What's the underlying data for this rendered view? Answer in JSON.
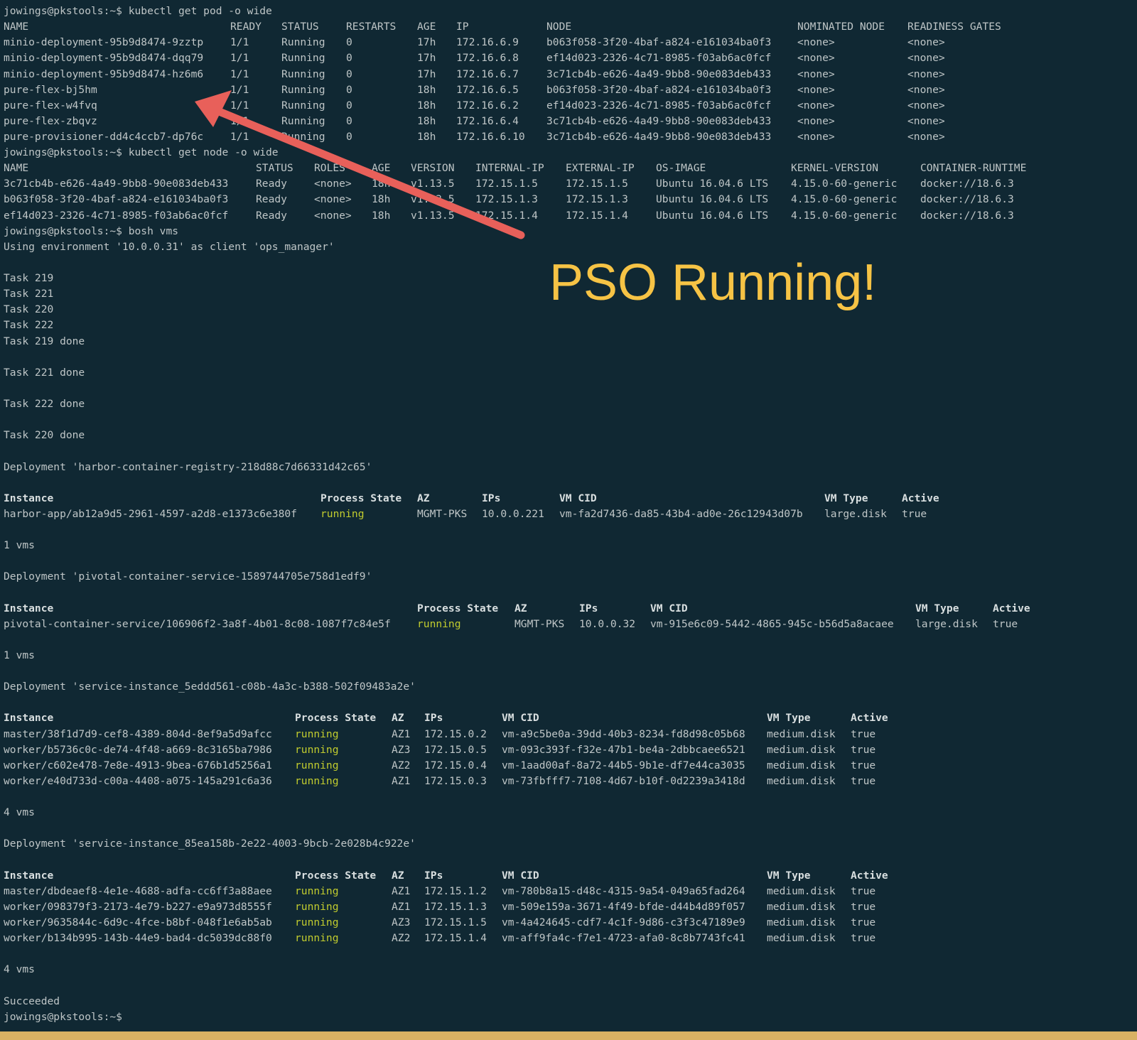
{
  "colors": {
    "background": "#102833",
    "text": "#bfc6c7",
    "running": "#c2cc2e",
    "annotation_text": "#f6c345",
    "arrow": "#e8605a",
    "frame": "#d8b163"
  },
  "annotation": {
    "text": "PSO Running!"
  },
  "prompt": "jowings@pkstools:~$",
  "lines": [
    {
      "t": 0,
      "text": "jowings@pkstools:~$ kubectl get pod -o wide"
    },
    {
      "t": 1,
      "cols": [
        [
          0,
          "NAME"
        ],
        [
          319,
          "READY"
        ],
        [
          391,
          "STATUS"
        ],
        [
          482,
          "RESTARTS"
        ],
        [
          582,
          "AGE"
        ],
        [
          637,
          "IP"
        ],
        [
          764,
          "NODE"
        ],
        [
          1117,
          "NOMINATED NODE"
        ],
        [
          1272,
          "READINESS GATES"
        ]
      ]
    },
    {
      "t": 1,
      "cols": [
        [
          0,
          "minio-deployment-95b9d8474-9zztp"
        ],
        [
          319,
          "1/1"
        ],
        [
          391,
          "Running"
        ],
        [
          482,
          "0"
        ],
        [
          582,
          "17h"
        ],
        [
          637,
          "172.16.6.9"
        ],
        [
          764,
          "b063f058-3f20-4baf-a824-e161034ba0f3"
        ],
        [
          1117,
          "<none>"
        ],
        [
          1272,
          "<none>"
        ]
      ]
    },
    {
      "t": 1,
      "cols": [
        [
          0,
          "minio-deployment-95b9d8474-dqq79"
        ],
        [
          319,
          "1/1"
        ],
        [
          391,
          "Running"
        ],
        [
          482,
          "0"
        ],
        [
          582,
          "17h"
        ],
        [
          637,
          "172.16.6.8"
        ],
        [
          764,
          "ef14d023-2326-4c71-8985-f03ab6ac0fcf"
        ],
        [
          1117,
          "<none>"
        ],
        [
          1272,
          "<none>"
        ]
      ]
    },
    {
      "t": 1,
      "cols": [
        [
          0,
          "minio-deployment-95b9d8474-hz6m6"
        ],
        [
          319,
          "1/1"
        ],
        [
          391,
          "Running"
        ],
        [
          482,
          "0"
        ],
        [
          582,
          "17h"
        ],
        [
          637,
          "172.16.6.7"
        ],
        [
          764,
          "3c71cb4b-e626-4a49-9bb8-90e083deb433"
        ],
        [
          1117,
          "<none>"
        ],
        [
          1272,
          "<none>"
        ]
      ]
    },
    {
      "t": 1,
      "cols": [
        [
          0,
          "pure-flex-bj5hm"
        ],
        [
          319,
          "1/1"
        ],
        [
          391,
          "Running"
        ],
        [
          482,
          "0"
        ],
        [
          582,
          "18h"
        ],
        [
          637,
          "172.16.6.5"
        ],
        [
          764,
          "b063f058-3f20-4baf-a824-e161034ba0f3"
        ],
        [
          1117,
          "<none>"
        ],
        [
          1272,
          "<none>"
        ]
      ]
    },
    {
      "t": 1,
      "cols": [
        [
          0,
          "pure-flex-w4fvq"
        ],
        [
          319,
          "1/1"
        ],
        [
          391,
          "Running"
        ],
        [
          482,
          "0"
        ],
        [
          582,
          "18h"
        ],
        [
          637,
          "172.16.6.2"
        ],
        [
          764,
          "ef14d023-2326-4c71-8985-f03ab6ac0fcf"
        ],
        [
          1117,
          "<none>"
        ],
        [
          1272,
          "<none>"
        ]
      ]
    },
    {
      "t": 1,
      "cols": [
        [
          0,
          "pure-flex-zbqvz"
        ],
        [
          319,
          "1/1"
        ],
        [
          391,
          "Running"
        ],
        [
          482,
          "0"
        ],
        [
          582,
          "18h"
        ],
        [
          637,
          "172.16.6.4"
        ],
        [
          764,
          "3c71cb4b-e626-4a49-9bb8-90e083deb433"
        ],
        [
          1117,
          "<none>"
        ],
        [
          1272,
          "<none>"
        ]
      ]
    },
    {
      "t": 1,
      "cols": [
        [
          0,
          "pure-provisioner-dd4c4ccb7-dp76c"
        ],
        [
          319,
          "1/1"
        ],
        [
          391,
          "Running"
        ],
        [
          482,
          "0"
        ],
        [
          582,
          "18h"
        ],
        [
          637,
          "172.16.6.10"
        ],
        [
          764,
          "3c71cb4b-e626-4a49-9bb8-90e083deb433"
        ],
        [
          1117,
          "<none>"
        ],
        [
          1272,
          "<none>"
        ]
      ]
    },
    {
      "t": 0,
      "text": "jowings@pkstools:~$ kubectl get node -o wide"
    },
    {
      "t": 1,
      "cols": [
        [
          0,
          "NAME"
        ],
        [
          355,
          "STATUS"
        ],
        [
          437,
          "ROLES"
        ],
        [
          518,
          "AGE"
        ],
        [
          573,
          "VERSION"
        ],
        [
          664,
          "INTERNAL-IP"
        ],
        [
          791,
          "EXTERNAL-IP"
        ],
        [
          918,
          "OS-IMAGE"
        ],
        [
          1108,
          "KERNEL-VERSION"
        ],
        [
          1290,
          "CONTAINER-RUNTIME"
        ]
      ]
    },
    {
      "t": 1,
      "cols": [
        [
          0,
          "3c71cb4b-e626-4a49-9bb8-90e083deb433"
        ],
        [
          355,
          "Ready"
        ],
        [
          437,
          "<none>"
        ],
        [
          518,
          "18h"
        ],
        [
          573,
          "v1.13.5"
        ],
        [
          664,
          "172.15.1.5"
        ],
        [
          791,
          "172.15.1.5"
        ],
        [
          918,
          "Ubuntu 16.04.6 LTS"
        ],
        [
          1108,
          "4.15.0-60-generic"
        ],
        [
          1290,
          "docker://18.6.3"
        ]
      ]
    },
    {
      "t": 1,
      "cols": [
        [
          0,
          "b063f058-3f20-4baf-a824-e161034ba0f3"
        ],
        [
          355,
          "Ready"
        ],
        [
          437,
          "<none>"
        ],
        [
          518,
          "18h"
        ],
        [
          573,
          "v1.13.5"
        ],
        [
          664,
          "172.15.1.3"
        ],
        [
          791,
          "172.15.1.3"
        ],
        [
          918,
          "Ubuntu 16.04.6 LTS"
        ],
        [
          1108,
          "4.15.0-60-generic"
        ],
        [
          1290,
          "docker://18.6.3"
        ]
      ]
    },
    {
      "t": 1,
      "cols": [
        [
          0,
          "ef14d023-2326-4c71-8985-f03ab6ac0fcf"
        ],
        [
          355,
          "Ready"
        ],
        [
          437,
          "<none>"
        ],
        [
          518,
          "18h"
        ],
        [
          573,
          "v1.13.5"
        ],
        [
          664,
          "172.15.1.4"
        ],
        [
          791,
          "172.15.1.4"
        ],
        [
          918,
          "Ubuntu 16.04.6 LTS"
        ],
        [
          1108,
          "4.15.0-60-generic"
        ],
        [
          1290,
          "docker://18.6.3"
        ]
      ]
    },
    {
      "t": 0,
      "text": "jowings@pkstools:~$ bosh vms"
    },
    {
      "t": 0,
      "text": "Using environment '10.0.0.31' as client 'ops_manager'"
    },
    {
      "t": 0,
      "text": ""
    },
    {
      "t": 0,
      "text": "Task 219"
    },
    {
      "t": 0,
      "text": "Task 221"
    },
    {
      "t": 0,
      "text": "Task 220"
    },
    {
      "t": 0,
      "text": "Task 222"
    },
    {
      "t": 0,
      "text": "Task 219 done"
    },
    {
      "t": 0,
      "text": ""
    },
    {
      "t": 0,
      "text": "Task 221 done"
    },
    {
      "t": 0,
      "text": ""
    },
    {
      "t": 0,
      "text": "Task 222 done"
    },
    {
      "t": 0,
      "text": ""
    },
    {
      "t": 0,
      "text": "Task 220 done"
    },
    {
      "t": 0,
      "text": ""
    },
    {
      "t": 0,
      "text": "Deployment 'harbor-container-registry-218d88c7d66331d42c65'"
    },
    {
      "t": 0,
      "text": ""
    },
    {
      "t": 2,
      "cols": [
        [
          0,
          "Instance"
        ],
        [
          446,
          "Process State"
        ],
        [
          582,
          "AZ"
        ],
        [
          673,
          "IPs"
        ],
        [
          782,
          "VM CID"
        ],
        [
          1155,
          "VM Type"
        ],
        [
          1264,
          "Active"
        ]
      ]
    },
    {
      "t": 1,
      "run": 1,
      "cols": [
        [
          0,
          "harbor-app/ab12a9d5-2961-4597-a2d8-e1373c6e380f"
        ],
        [
          446,
          "running"
        ],
        [
          582,
          "MGMT-PKS"
        ],
        [
          673,
          "10.0.0.221"
        ],
        [
          782,
          "vm-fa2d7436-da85-43b4-ad0e-26c12943d07b"
        ],
        [
          1155,
          "large.disk"
        ],
        [
          1264,
          "true"
        ]
      ]
    },
    {
      "t": 0,
      "text": ""
    },
    {
      "t": 0,
      "text": "1 vms"
    },
    {
      "t": 0,
      "text": ""
    },
    {
      "t": 0,
      "text": "Deployment 'pivotal-container-service-1589744705e758d1edf9'"
    },
    {
      "t": 0,
      "text": ""
    },
    {
      "t": 2,
      "cols": [
        [
          0,
          "Instance"
        ],
        [
          582,
          "Process State"
        ],
        [
          719,
          "AZ"
        ],
        [
          810,
          "IPs"
        ],
        [
          910,
          "VM CID"
        ],
        [
          1283,
          "VM Type"
        ],
        [
          1392,
          "Active"
        ]
      ]
    },
    {
      "t": 1,
      "run": 1,
      "cols": [
        [
          0,
          "pivotal-container-service/106906f2-3a8f-4b01-8c08-1087f7c84e5f"
        ],
        [
          582,
          "running"
        ],
        [
          719,
          "MGMT-PKS"
        ],
        [
          810,
          "10.0.0.32"
        ],
        [
          910,
          "vm-915e6c09-5442-4865-945c-b56d5a8acaee"
        ],
        [
          1283,
          "large.disk"
        ],
        [
          1392,
          "true"
        ]
      ]
    },
    {
      "t": 0,
      "text": ""
    },
    {
      "t": 0,
      "text": "1 vms"
    },
    {
      "t": 0,
      "text": ""
    },
    {
      "t": 0,
      "text": "Deployment 'service-instance_5eddd561-c08b-4a3c-b388-502f09483a2e'"
    },
    {
      "t": 0,
      "text": ""
    },
    {
      "t": 2,
      "cols": [
        [
          0,
          "Instance"
        ],
        [
          410,
          "Process State"
        ],
        [
          546,
          "AZ"
        ],
        [
          592,
          "IPs"
        ],
        [
          701,
          "VM CID"
        ],
        [
          1074,
          "VM Type"
        ],
        [
          1192,
          "Active"
        ]
      ]
    },
    {
      "t": 1,
      "run": 1,
      "cols": [
        [
          0,
          "master/38f1d7d9-cef8-4389-804d-8ef9a5d9afcc"
        ],
        [
          410,
          "running"
        ],
        [
          546,
          "AZ1"
        ],
        [
          592,
          "172.15.0.2"
        ],
        [
          701,
          "vm-a9c5be0a-39dd-40b3-8234-fd8d98c05b68"
        ],
        [
          1074,
          "medium.disk"
        ],
        [
          1192,
          "true"
        ]
      ]
    },
    {
      "t": 1,
      "run": 1,
      "cols": [
        [
          0,
          "worker/b5736c0c-de74-4f48-a669-8c3165ba7986"
        ],
        [
          410,
          "running"
        ],
        [
          546,
          "AZ3"
        ],
        [
          592,
          "172.15.0.5"
        ],
        [
          701,
          "vm-093c393f-f32e-47b1-be4a-2dbbcaee6521"
        ],
        [
          1074,
          "medium.disk"
        ],
        [
          1192,
          "true"
        ]
      ]
    },
    {
      "t": 1,
      "run": 1,
      "cols": [
        [
          0,
          "worker/c602e478-7e8e-4913-9bea-676b1d5256a1"
        ],
        [
          410,
          "running"
        ],
        [
          546,
          "AZ2"
        ],
        [
          592,
          "172.15.0.4"
        ],
        [
          701,
          "vm-1aad00af-8a72-44b5-9b1e-df7e44ca3035"
        ],
        [
          1074,
          "medium.disk"
        ],
        [
          1192,
          "true"
        ]
      ]
    },
    {
      "t": 1,
      "run": 1,
      "cols": [
        [
          0,
          "worker/e40d733d-c00a-4408-a075-145a291c6a36"
        ],
        [
          410,
          "running"
        ],
        [
          546,
          "AZ1"
        ],
        [
          592,
          "172.15.0.3"
        ],
        [
          701,
          "vm-73fbfff7-7108-4d67-b10f-0d2239a3418d"
        ],
        [
          1074,
          "medium.disk"
        ],
        [
          1192,
          "true"
        ]
      ]
    },
    {
      "t": 0,
      "text": ""
    },
    {
      "t": 0,
      "text": "4 vms"
    },
    {
      "t": 0,
      "text": ""
    },
    {
      "t": 0,
      "text": "Deployment 'service-instance_85ea158b-2e22-4003-9bcb-2e028b4c922e'"
    },
    {
      "t": 0,
      "text": ""
    },
    {
      "t": 2,
      "cols": [
        [
          0,
          "Instance"
        ],
        [
          410,
          "Process State"
        ],
        [
          546,
          "AZ"
        ],
        [
          592,
          "IPs"
        ],
        [
          701,
          "VM CID"
        ],
        [
          1074,
          "VM Type"
        ],
        [
          1192,
          "Active"
        ]
      ]
    },
    {
      "t": 1,
      "run": 1,
      "cols": [
        [
          0,
          "master/dbdeaef8-4e1e-4688-adfa-cc6ff3a88aee"
        ],
        [
          410,
          "running"
        ],
        [
          546,
          "AZ1"
        ],
        [
          592,
          "172.15.1.2"
        ],
        [
          701,
          "vm-780b8a15-d48c-4315-9a54-049a65fad264"
        ],
        [
          1074,
          "medium.disk"
        ],
        [
          1192,
          "true"
        ]
      ]
    },
    {
      "t": 1,
      "run": 1,
      "cols": [
        [
          0,
          "worker/098379f3-2173-4e79-b227-e9a973d8555f"
        ],
        [
          410,
          "running"
        ],
        [
          546,
          "AZ1"
        ],
        [
          592,
          "172.15.1.3"
        ],
        [
          701,
          "vm-509e159a-3671-4f49-bfde-d44b4d89f057"
        ],
        [
          1074,
          "medium.disk"
        ],
        [
          1192,
          "true"
        ]
      ]
    },
    {
      "t": 1,
      "run": 1,
      "cols": [
        [
          0,
          "worker/9635844c-6d9c-4fce-b8bf-048f1e6ab5ab"
        ],
        [
          410,
          "running"
        ],
        [
          546,
          "AZ3"
        ],
        [
          592,
          "172.15.1.5"
        ],
        [
          701,
          "vm-4a424645-cdf7-4c1f-9d86-c3f3c47189e9"
        ],
        [
          1074,
          "medium.disk"
        ],
        [
          1192,
          "true"
        ]
      ]
    },
    {
      "t": 1,
      "run": 1,
      "cols": [
        [
          0,
          "worker/b134b995-143b-44e9-bad4-dc5039dc88f0"
        ],
        [
          410,
          "running"
        ],
        [
          546,
          "AZ2"
        ],
        [
          592,
          "172.15.1.4"
        ],
        [
          701,
          "vm-aff9fa4c-f7e1-4723-afa0-8c8b7743fc41"
        ],
        [
          1074,
          "medium.disk"
        ],
        [
          1192,
          "true"
        ]
      ]
    },
    {
      "t": 0,
      "text": ""
    },
    {
      "t": 0,
      "text": "4 vms"
    },
    {
      "t": 0,
      "text": ""
    },
    {
      "t": 0,
      "text": "Succeeded"
    },
    {
      "t": 0,
      "text": "jowings@pkstools:~$"
    }
  ]
}
